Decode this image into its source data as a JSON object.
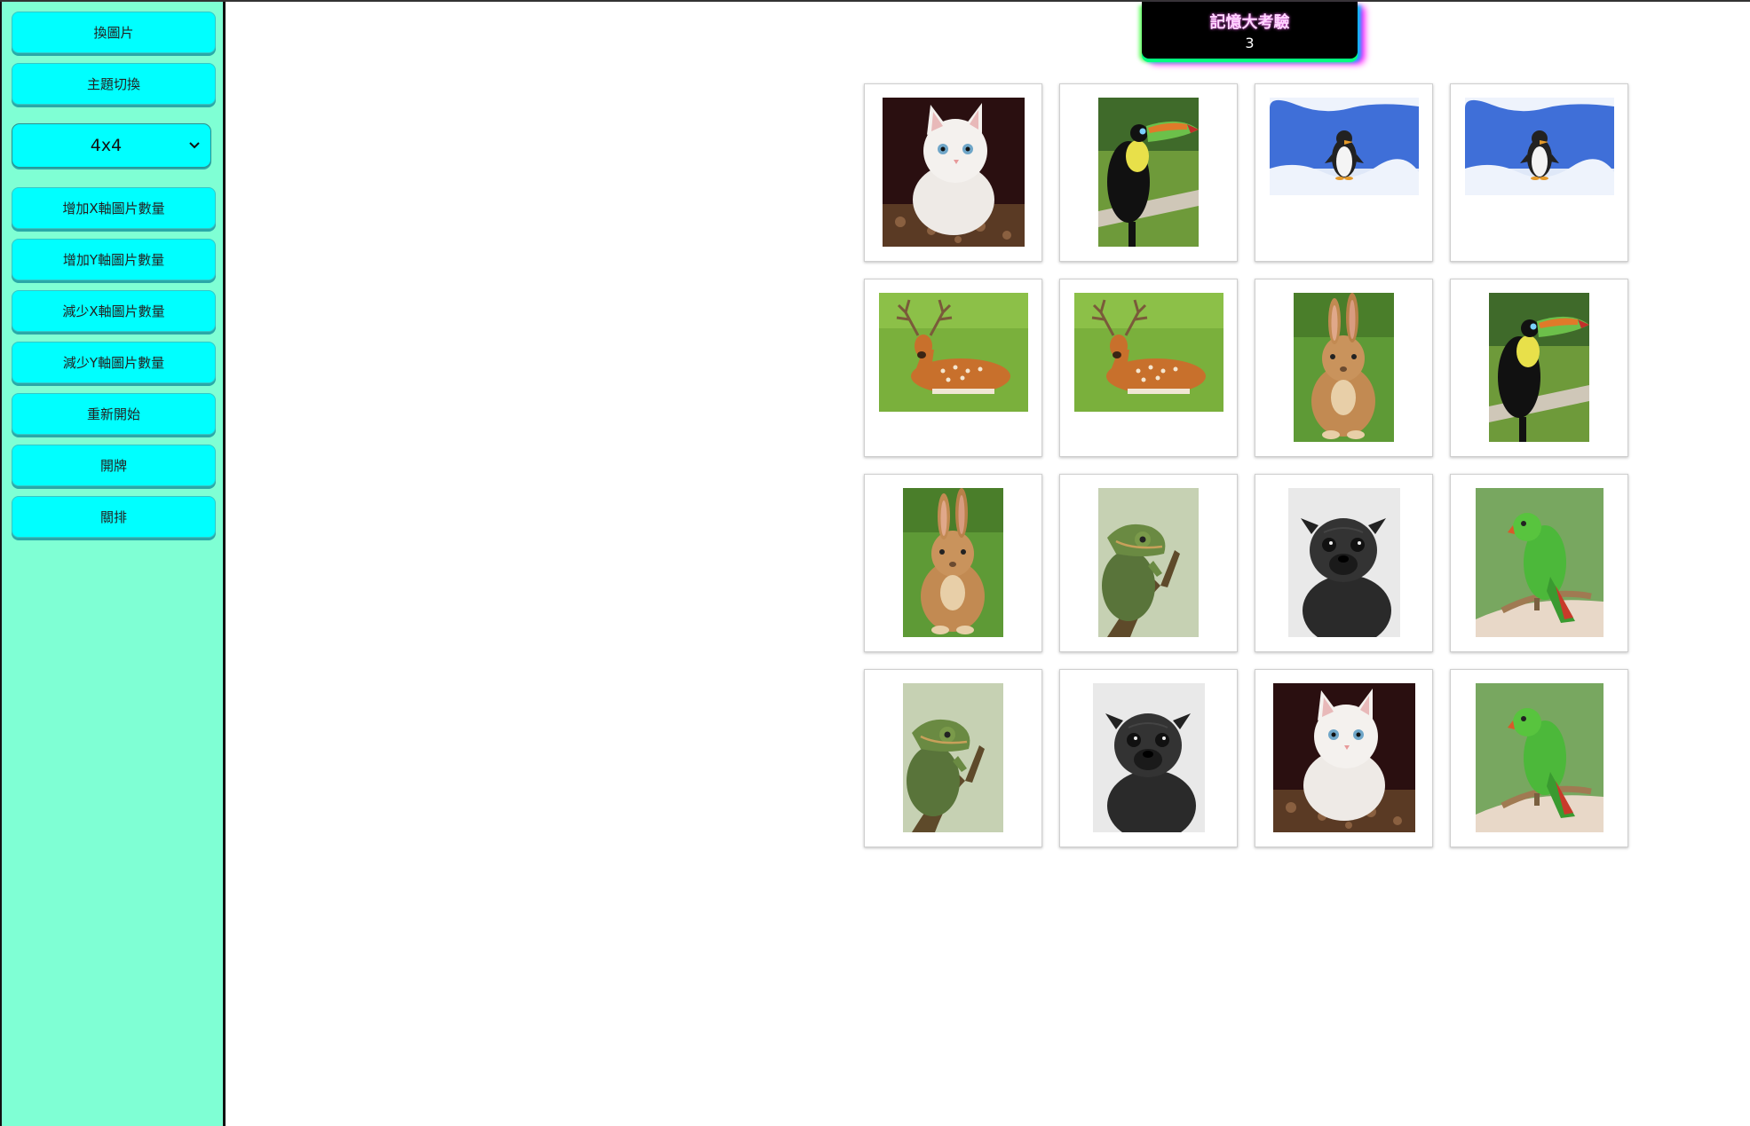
{
  "sidebar": {
    "buttons": [
      "換圖片",
      "主題切換",
      "增加X軸圖片數量",
      "增加Y軸圖片數量",
      "減少X軸圖片數量",
      "減少Y軸圖片數量",
      "重新開始",
      "開牌",
      "關排"
    ],
    "grid_select": {
      "value": "4x4"
    }
  },
  "header": {
    "title": "記憶大考驗",
    "count": "3"
  },
  "board": {
    "rows": 4,
    "cols": 4,
    "cards": [
      "kitten",
      "toucan",
      "penguin",
      "penguin",
      "deer",
      "deer",
      "rabbit",
      "toucan",
      "rabbit",
      "chameleon",
      "pug",
      "parrot",
      "chameleon",
      "pug",
      "kitten",
      "parrot"
    ]
  },
  "colors": {
    "sidebar_bg": "#7fffd4",
    "button_bg": "#00ffff",
    "title_bg": "#000000"
  }
}
